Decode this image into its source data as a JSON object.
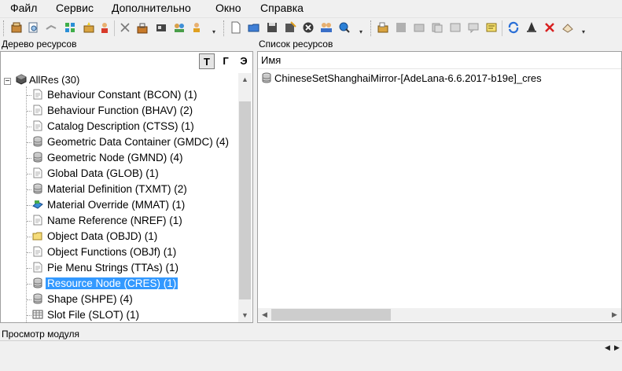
{
  "menu": [
    "Файл",
    "Сервис",
    "Дополнительно",
    "Окно",
    "Справка"
  ],
  "left_panel": {
    "title": "Дерево ресурсов",
    "view_buttons": [
      "Т",
      "Г",
      "Э"
    ],
    "root": "AllRes (30)",
    "items": [
      {
        "label": "Behaviour Constant (BCON) (1)",
        "icon": "document-icon"
      },
      {
        "label": "Behaviour Function (BHAV) (2)",
        "icon": "document-icon"
      },
      {
        "label": "Catalog Description (CTSS) (1)",
        "icon": "document-icon"
      },
      {
        "label": "Geometric Data Container (GMDC) (4)",
        "icon": "database-icon"
      },
      {
        "label": "Geometric Node (GMND) (4)",
        "icon": "database-icon"
      },
      {
        "label": "Global Data (GLOB) (1)",
        "icon": "document-icon"
      },
      {
        "label": "Material Definition (TXMT) (2)",
        "icon": "database-icon"
      },
      {
        "label": "Material Override (MMAT) (1)",
        "icon": "material-icon"
      },
      {
        "label": "Name Reference (NREF) (1)",
        "icon": "document-icon"
      },
      {
        "label": "Object Data (OBJD) (1)",
        "icon": "folder-icon"
      },
      {
        "label": "Object Functions (OBJf) (1)",
        "icon": "document-icon"
      },
      {
        "label": "Pie Menu Strings (TTAs) (1)",
        "icon": "document-icon"
      },
      {
        "label": "Resource Node (CRES) (1)",
        "icon": "database-icon",
        "selected": true
      },
      {
        "label": "Shape (SHPE) (4)",
        "icon": "database-icon"
      },
      {
        "label": "Slot File (SLOT) (1)",
        "icon": "grid-icon"
      }
    ]
  },
  "right_panel": {
    "title": "Список ресурсов",
    "column": "Имя",
    "items": [
      "ChineseSetShanghaiMirror-[AdeLana-6.6.2017-b19e]_cres"
    ]
  },
  "bottom_panel": {
    "title": "Просмотр модуля"
  },
  "colors": {
    "selection": "#3399ff",
    "background": "#f0f0f0"
  }
}
